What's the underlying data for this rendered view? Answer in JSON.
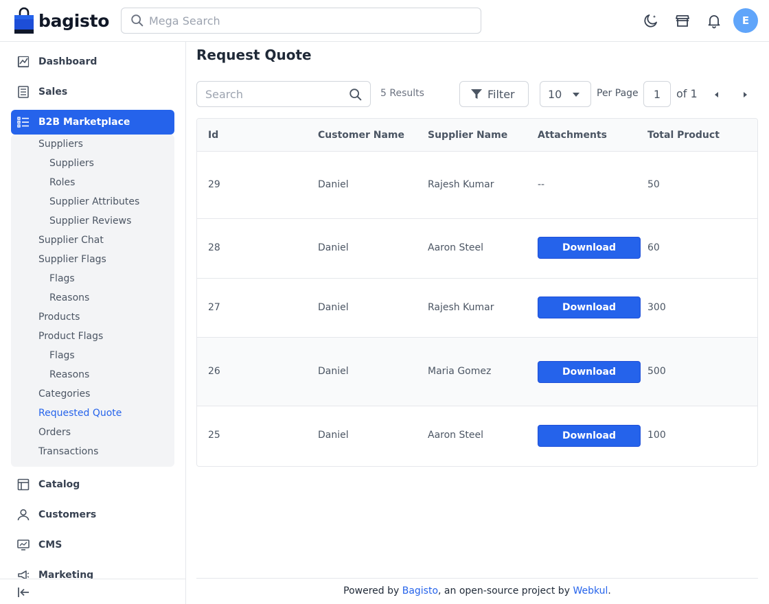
{
  "header": {
    "brand": "bagisto",
    "search_placeholder": "Mega Search",
    "avatar_initial": "E"
  },
  "sidebar": {
    "items": [
      {
        "label": "Dashboard",
        "icon": "dashboard-icon"
      },
      {
        "label": "Sales",
        "icon": "sales-icon"
      },
      {
        "label": "B2B Marketplace",
        "icon": "list-icon",
        "active": true
      },
      {
        "label": "Catalog",
        "icon": "catalog-icon"
      },
      {
        "label": "Customers",
        "icon": "customer-icon"
      },
      {
        "label": "CMS",
        "icon": "cms-icon"
      },
      {
        "label": "Marketing",
        "icon": "megaphone-icon"
      }
    ],
    "b2b_children": [
      {
        "label": "Suppliers",
        "level": 1
      },
      {
        "label": "Suppliers",
        "level": 2
      },
      {
        "label": "Roles",
        "level": 2
      },
      {
        "label": "Supplier Attributes",
        "level": 2
      },
      {
        "label": "Supplier Reviews",
        "level": 2
      },
      {
        "label": "Supplier Chat",
        "level": 1
      },
      {
        "label": "Supplier Flags",
        "level": 1
      },
      {
        "label": "Flags",
        "level": 2
      },
      {
        "label": "Reasons",
        "level": 2
      },
      {
        "label": "Products",
        "level": 1
      },
      {
        "label": "Product Flags",
        "level": 1
      },
      {
        "label": "Flags",
        "level": 2
      },
      {
        "label": "Reasons",
        "level": 2
      },
      {
        "label": "Categories",
        "level": 1
      },
      {
        "label": "Requested Quote",
        "level": 1,
        "current": true
      },
      {
        "label": "Orders",
        "level": 1
      },
      {
        "label": "Transactions",
        "level": 1
      }
    ]
  },
  "main": {
    "title": "Request Quote",
    "search_placeholder": "Search",
    "results": "5 Results",
    "filter_label": "Filter",
    "per_page_value": "10",
    "per_page_label": "Per Page",
    "current_page": "1",
    "page_of": "of 1"
  },
  "table": {
    "columns": [
      "Id",
      "Customer Name",
      "Supplier Name",
      "Attachments",
      "Total Product"
    ],
    "rows": [
      {
        "id": "29",
        "customer": "Daniel",
        "supplier": "Rajesh Kumar",
        "attachment": "--",
        "total": "50"
      },
      {
        "id": "28",
        "customer": "Daniel",
        "supplier": "Aaron Steel",
        "attachment": "Download",
        "total": "60"
      },
      {
        "id": "27",
        "customer": "Daniel",
        "supplier": "Rajesh Kumar",
        "attachment": "Download",
        "total": "300"
      },
      {
        "id": "26",
        "customer": "Daniel",
        "supplier": "Maria Gomez",
        "attachment": "Download",
        "total": "500"
      },
      {
        "id": "25",
        "customer": "Daniel",
        "supplier": "Aaron Steel",
        "attachment": "Download",
        "total": "100"
      }
    ]
  },
  "footer": {
    "prefix": "Powered by ",
    "link1": "Bagisto",
    "middle": ", an open-source project by ",
    "link2": "Webkul",
    "suffix": "."
  },
  "colors": {
    "accent": "#2563eb",
    "avatar": "#60a5fa"
  }
}
